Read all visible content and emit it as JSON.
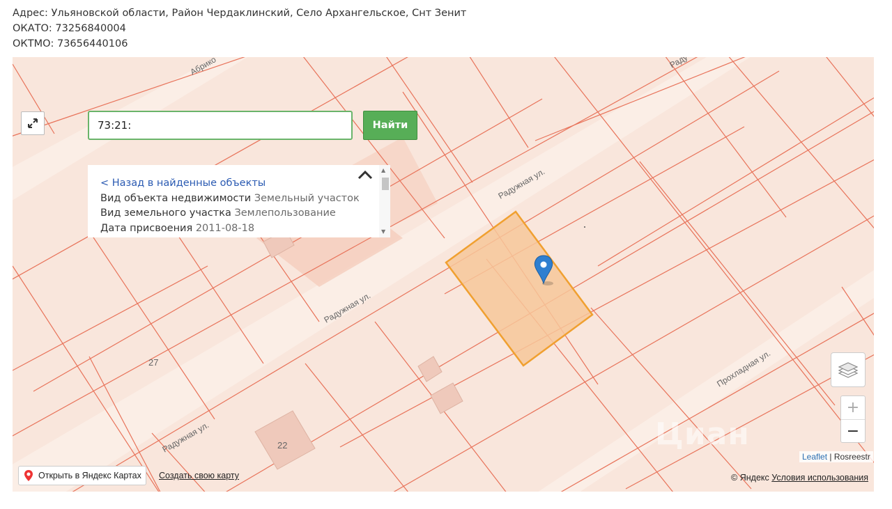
{
  "address": {
    "line1": "Адрес: Ульяновской области, Район Чердаклинский, Село Архангельское, Снт Зенит",
    "okato": "ОКАТО: 73256840004",
    "oktmo": "ОКТМО: 73656440106"
  },
  "search": {
    "value": "73:21:",
    "button_label": "Найти"
  },
  "info_panel": {
    "back_link": "< Назад в найденные объекты",
    "rows": [
      {
        "label": "Вид объекта недвижимости",
        "value": "Земельный участок"
      },
      {
        "label": "Вид земельного участка",
        "value": "Землепользование"
      },
      {
        "label": "Дата присвоения",
        "value": "2011-08-18"
      }
    ]
  },
  "map": {
    "streets": [
      "Абрико",
      "Раду",
      "Радужная ул.",
      "Радужная ул.",
      "Радужная ул.",
      "Прохладная ул."
    ],
    "plot_numbers": [
      "27",
      "22"
    ],
    "colors": {
      "background": "#f9e6dc",
      "parcel_line": "#e8735a",
      "selected_fill": "#f7c79a",
      "selected_border": "#f0a030",
      "marker": "#2f7fd0"
    }
  },
  "controls": {
    "zoom_in": "+",
    "zoom_out": "−",
    "attribution_leaflet": "Leaflet",
    "attribution_sep": " | ",
    "attribution_source": "Rosreestr",
    "open_yandex": "Открыть в Яндекс Картах",
    "create_map": "Создать свою карту",
    "copyright": "© Яндекс",
    "terms": "Условия использования"
  },
  "watermark": {
    "main": "Циан",
    "sub": ""
  }
}
